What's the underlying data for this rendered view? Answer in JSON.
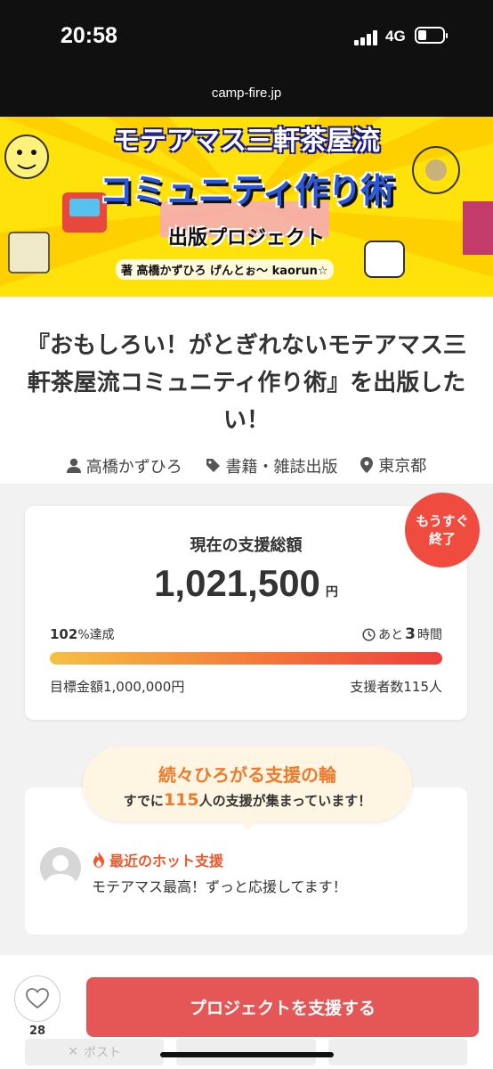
{
  "status_bar": {
    "time": "20:58",
    "network": "4G"
  },
  "browser": {
    "url": "camp-fire.jp"
  },
  "hero": {
    "line1": "モテアマス三軒茶屋流",
    "line2": "コミュニティ作り術",
    "line3": "出版プロジェクト",
    "authors": "著 高橋かずひろ げんとぉ〜 kaorun☆"
  },
  "project": {
    "title": "『おもしろい！がとぎれないモテアマス三軒茶屋流コミュニティ作り術』を出版したい！",
    "owner": "高橋かずひろ",
    "category": "書籍・雑誌出版",
    "location": "東京都"
  },
  "funding": {
    "label": "現在の支援総額",
    "amount": "1,021,500",
    "unit": "円",
    "achievement_value": "102",
    "achievement_suffix": "%達成",
    "progress_fraction": 1.0,
    "remaining_prefix": "あと",
    "remaining_value": "3",
    "remaining_suffix": "時間",
    "goal": "目標金額1,000,000円",
    "supporters": "支援者数115人",
    "badge_line1": "もうすぐ",
    "badge_line2": "終了"
  },
  "hot_support": {
    "bubble_title": "続々ひろがる支援の輪",
    "bubble_prefix": "すでに",
    "bubble_count": "115",
    "bubble_suffix": "人の支援が集まっています！",
    "label": "最近のホット支援",
    "comment": "モテアマス最高！ずっと応援してます！"
  },
  "actions": {
    "like_count": "28",
    "support_button": "プロジェクトを支援する",
    "share_post": "ポスト"
  },
  "colors": {
    "accent": "#e55656",
    "badge": "#ef4b3e",
    "hot": "#f07a2a"
  }
}
